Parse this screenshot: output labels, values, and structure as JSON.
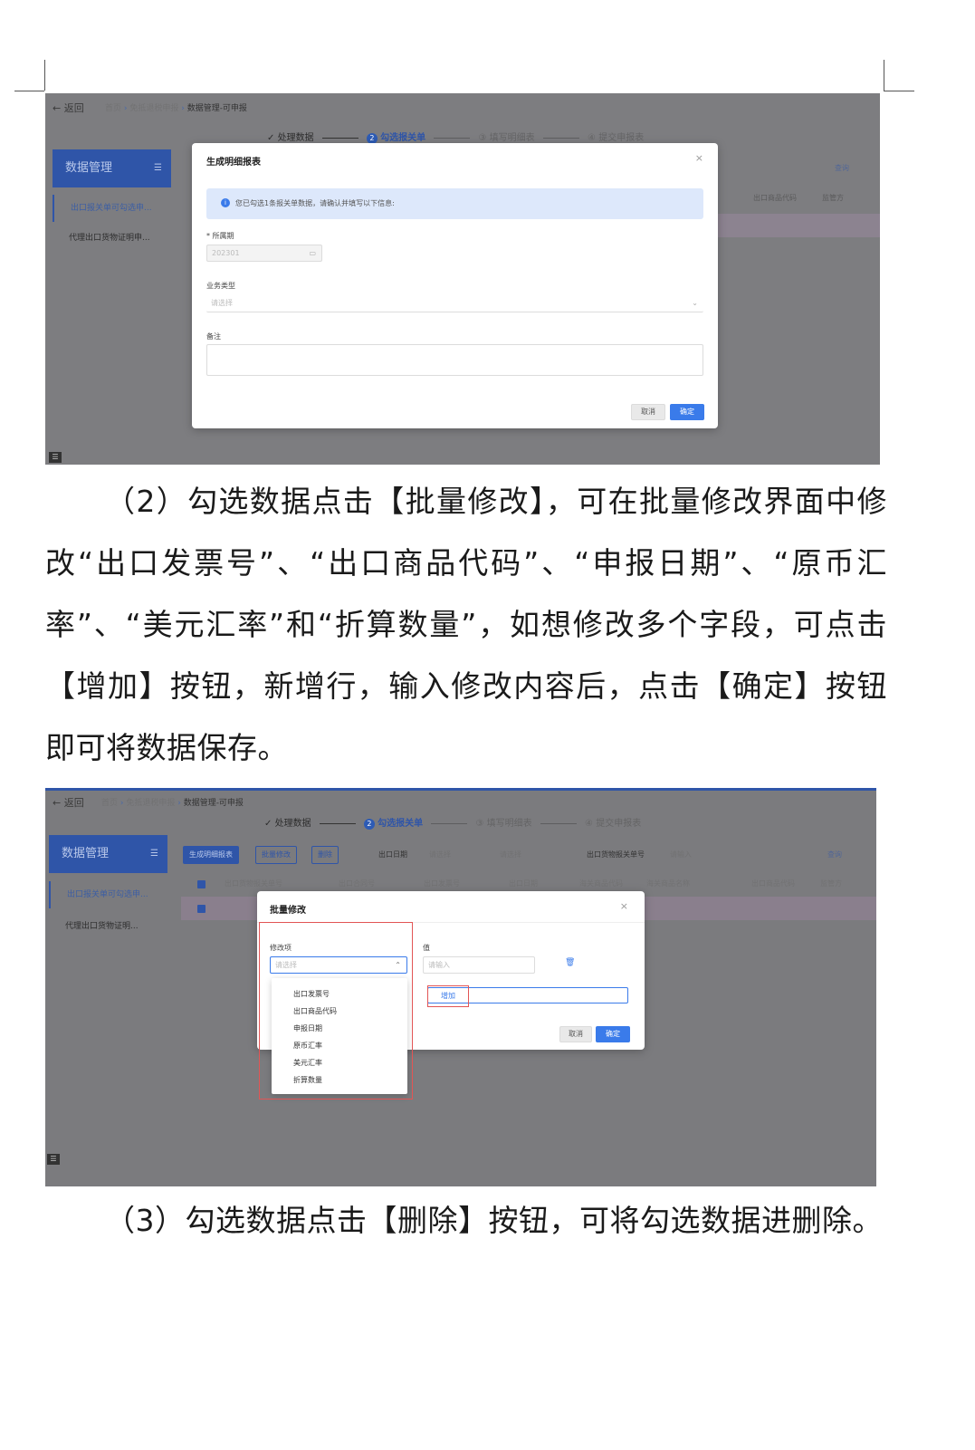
{
  "shot1": {
    "back_label": "← 返回",
    "breadcrumb": [
      "首页",
      "免抵退税申报",
      "数据管理-可申报"
    ],
    "steps": [
      "处理数据",
      "勾选报关单",
      "填写明细表",
      "提交申报表"
    ],
    "sidebar_title": "数据管理",
    "sidebar_items": [
      "出口报关单可勾选申...",
      "代理出口货物证明申..."
    ],
    "right_link": "查询",
    "right_cols": [
      "出口商品代码",
      "监管方"
    ],
    "modal": {
      "title": "生成明细报表",
      "close": "×",
      "info": "您已勾选1条报关单数据，请确认并填写以下信息:",
      "period_label": "* 所属期",
      "period_value": "202301",
      "biz_label": "业务类型",
      "biz_placeholder": "请选择",
      "remark_label": "备注",
      "cancel": "取消",
      "confirm": "确定"
    }
  },
  "paragraph2": "（2）勾选数据点击【批量修改】，可在批量修改界面中修改“出口发票号”、“出口商品代码”、“申报日期”、“原币汇率”、“美元汇率”和“折算数量”，如想修改多个字段，可点击【增加】按钮，新增行，输入修改内容后，点击【确定】按钮即可将数据保存。",
  "shot2": {
    "back_label": "← 返回",
    "breadcrumb": [
      "首页",
      "免抵退税申报",
      "数据管理-可申报"
    ],
    "steps": [
      "处理数据",
      "勾选报关单",
      "填写明细表",
      "提交申报表"
    ],
    "sidebar_title": "数据管理",
    "sidebar_items": [
      "出口报关单可勾选申...",
      "代理出口货物证明..."
    ],
    "toolbar": [
      "生成明细报表",
      "批量修改",
      "删除"
    ],
    "filter_labels": [
      "出口日期",
      "出口货物报关单号"
    ],
    "filter_placeholders": [
      "请选择",
      "请选择",
      "请输入"
    ],
    "query": "查询",
    "columns": [
      "出口货物报关单号",
      "出口合同号",
      "出口发票号",
      "出口日期",
      "海关商品代码",
      "海关商品名称",
      "出口商品代码",
      "监管方"
    ],
    "modal": {
      "title": "批量修改",
      "close": "×",
      "field_label": "修改项",
      "field_placeholder": "请选择",
      "value_label": "值",
      "value_placeholder": "请输入",
      "add": "增加",
      "cancel": "取消",
      "confirm": "确定",
      "options": [
        "出口发票号",
        "出口商品代码",
        "申报日期",
        "原币汇率",
        "美元汇率",
        "折算数量"
      ]
    }
  },
  "paragraph3": "（3）勾选数据点击【删除】按钮，可将勾选数据进删除。",
  "colors": {
    "primary": "#2f55a8",
    "accent_button": "#3a7bea",
    "highlight_box": "#e25555"
  }
}
